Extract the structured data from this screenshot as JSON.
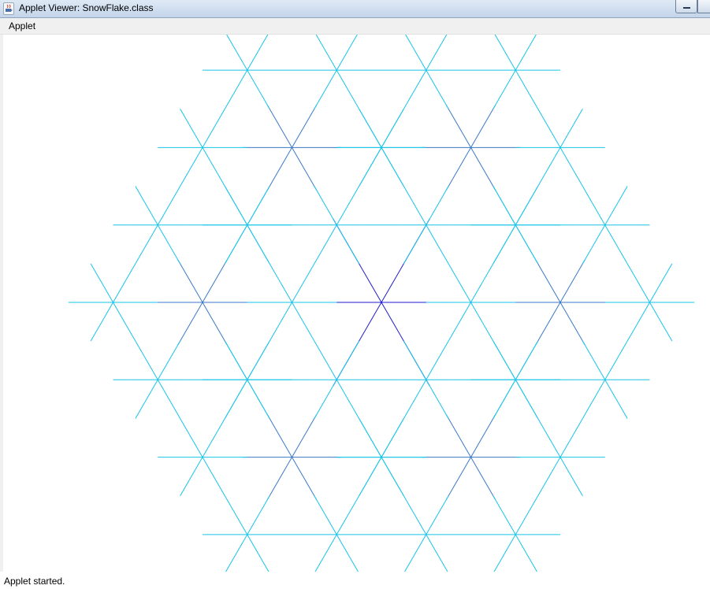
{
  "window": {
    "title": "Applet Viewer: SnowFlake.class",
    "icon": "java-cup-icon"
  },
  "menu": {
    "items": [
      {
        "label": "Applet"
      }
    ]
  },
  "status": {
    "text": "Applet started."
  },
  "snowflake": {
    "depth": 3,
    "arms": 6,
    "colors": {
      "trunk": "#1e1ecc",
      "branch": "#3a78c8",
      "tip": "#16c4e8"
    }
  }
}
